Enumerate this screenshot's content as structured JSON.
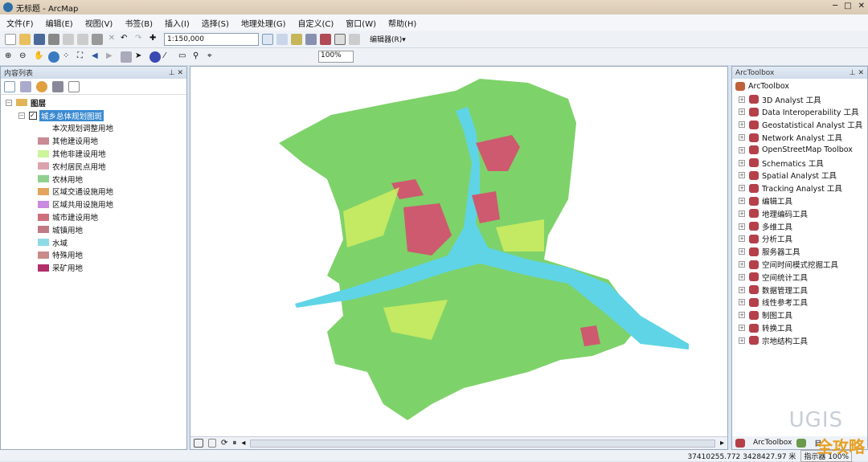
{
  "window": {
    "title": "无标题 - ArcMap"
  },
  "menu": [
    "文件(F)",
    "编辑(E)",
    "视图(V)",
    "书签(B)",
    "插入(I)",
    "选择(S)",
    "地理处理(G)",
    "自定义(C)",
    "窗口(W)",
    "帮助(H)"
  ],
  "toolbar": {
    "scale": "1:150,000",
    "editor": "编辑器(R)▾",
    "zoom_pct": "100%"
  },
  "toc": {
    "title": "内容列表",
    "root": "图层",
    "layer": "城乡总体规划图斑",
    "field": "本次规划调整用地",
    "legend": [
      {
        "label": "其他建设用地",
        "color": "#c98a94"
      },
      {
        "label": "其他非建设用地",
        "color": "#ccf59a"
      },
      {
        "label": "农村居民点用地",
        "color": "#dba4ad"
      },
      {
        "label": "农林用地",
        "color": "#8fd08f"
      },
      {
        "label": "区域交通设施用地",
        "color": "#e3a45e"
      },
      {
        "label": "区域共用设施用地",
        "color": "#c98ae0"
      },
      {
        "label": "城市建设用地",
        "color": "#cf6f7e"
      },
      {
        "label": "城镇用地",
        "color": "#c07a85"
      },
      {
        "label": "水域",
        "color": "#8edbe6"
      },
      {
        "label": "特殊用地",
        "color": "#c98a8a"
      },
      {
        "label": "采矿用地",
        "color": "#b0306a"
      }
    ]
  },
  "toolbox": {
    "title": "ArcToolbox",
    "root": "ArcToolbox",
    "items": [
      "3D Analyst 工具",
      "Data Interoperability 工具",
      "Geostatistical Analyst 工具",
      "Network Analyst 工具",
      "OpenStreetMap Toolbox",
      "Schematics 工具",
      "Spatial Analyst 工具",
      "Tracking Analyst 工具",
      "编辑工具",
      "地理编码工具",
      "多维工具",
      "分析工具",
      "服务器工具",
      "空间时间模式挖掘工具",
      "空间统计工具",
      "数据管理工具",
      "线性参考工具",
      "制图工具",
      "转换工具",
      "宗地结构工具"
    ],
    "tab1": "ArcToolbox",
    "tab2": "目"
  },
  "status": {
    "coords": "37410255.772  3428427.97 米",
    "zoom": "指示器 100%"
  },
  "watermark": "UGIS",
  "badge": "全攻略",
  "colors": {
    "land": "#7ed26a",
    "water": "#5fd4e6",
    "urban": "#cd5a6e",
    "other": "#d4f060"
  }
}
